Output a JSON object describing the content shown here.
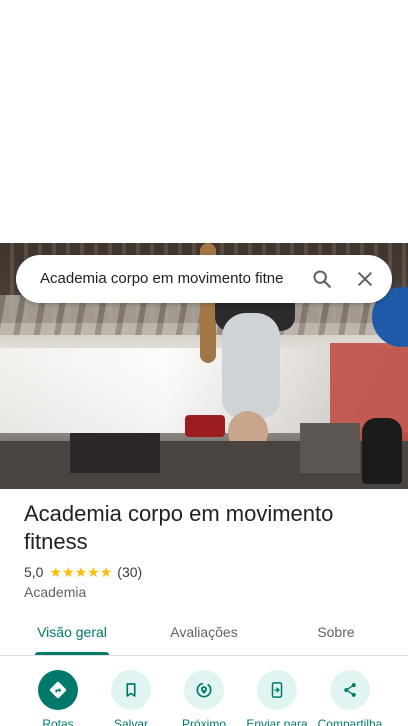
{
  "search": {
    "query": "Academia corpo em movimento fitne"
  },
  "place": {
    "name": "Academia corpo em movimento fitness",
    "rating": "5,0",
    "stars": 5,
    "review_count": "(30)",
    "category": "Academia"
  },
  "tabs": [
    {
      "label": "Visão geral",
      "active": true
    },
    {
      "label": "Avaliações",
      "active": false
    },
    {
      "label": "Sobre",
      "active": false
    }
  ],
  "actions": [
    {
      "label": "Rotas",
      "icon": "directions-icon"
    },
    {
      "label": "Salvar",
      "icon": "bookmark-icon"
    },
    {
      "label": "Próximo",
      "icon": "nearby-icon"
    },
    {
      "label": "Enviar para",
      "icon": "send-to-phone-icon"
    },
    {
      "label": "Compartilha",
      "icon": "share-icon"
    }
  ],
  "colors": {
    "accent": "#00796b",
    "accent_light": "#e0f5f2",
    "star": "#fbbc04"
  }
}
